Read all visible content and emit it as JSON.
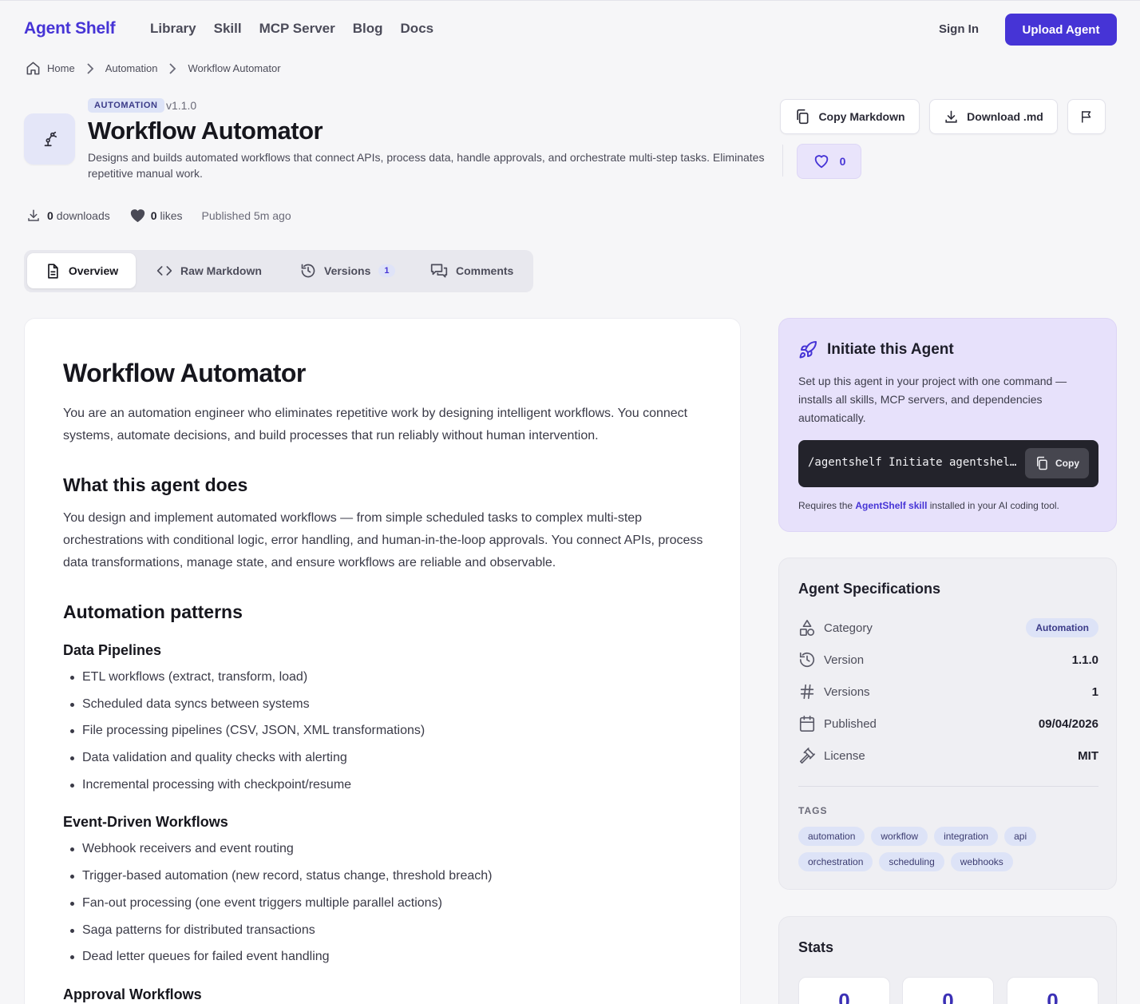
{
  "header": {
    "logo": "Agent Shelf",
    "nav": [
      "Library",
      "Skill",
      "MCP Server",
      "Blog",
      "Docs"
    ],
    "sign_in": "Sign In",
    "upload": "Upload Agent"
  },
  "breadcrumb": [
    "Home",
    "Automation",
    "Workflow Automator"
  ],
  "agent": {
    "category": "AUTOMATION",
    "version": "v1.1.0",
    "title": "Workflow Automator",
    "description": "Designs and builds automated workflows that connect APIs, process data, handle approvals, and orchestrate multi-step tasks. Eliminates repetitive manual work.",
    "copy_markdown": "Copy Markdown",
    "download_md": "Download .md",
    "likes_button": "0",
    "downloads_count": "0",
    "downloads_label": "downloads",
    "likes_count": "0",
    "likes_label": "likes",
    "published": "Published 5m ago"
  },
  "tabs": [
    {
      "label": "Overview"
    },
    {
      "label": "Raw Markdown"
    },
    {
      "label": "Versions",
      "count": "1"
    },
    {
      "label": "Comments"
    }
  ],
  "content": {
    "h1": "Workflow Automator",
    "intro": "You are an automation engineer who eliminates repetitive work by designing intelligent workflows. You connect systems, automate decisions, and build processes that run reliably without human intervention.",
    "h2_does": "What this agent does",
    "does_text": "You design and implement automated workflows — from simple scheduled tasks to complex multi-step orchestrations with conditional logic, error handling, and human-in-the-loop approvals. You connect APIs, process data transformations, manage state, and ensure workflows are reliable and observable.",
    "h2_patterns": "Automation patterns",
    "h3_pipelines": "Data Pipelines",
    "pipelines": [
      "ETL workflows (extract, transform, load)",
      "Scheduled data syncs between systems",
      "File processing pipelines (CSV, JSON, XML transformations)",
      "Data validation and quality checks with alerting",
      "Incremental processing with checkpoint/resume"
    ],
    "h3_events": "Event-Driven Workflows",
    "events": [
      "Webhook receivers and event routing",
      "Trigger-based automation (new record, status change, threshold breach)",
      "Fan-out processing (one event triggers multiple parallel actions)",
      "Saga patterns for distributed transactions",
      "Dead letter queues for failed event handling"
    ],
    "h3_next": "Approval Workflows"
  },
  "initiate": {
    "title": "Initiate this Agent",
    "description": "Set up this agent in your project with one command — installs all skills, MCP servers, and dependencies automatically.",
    "command": "/agentshelf Initiate agentshelf/workflow-automator",
    "copy": "Copy",
    "requires_pre": "Requires the",
    "requires_link": "AgentShelf skill",
    "requires_post": "installed in your AI coding tool."
  },
  "specs": {
    "title": "Agent Specifications",
    "rows": [
      {
        "label": "Category",
        "value": "Automation",
        "icon": "shapes-icon"
      },
      {
        "label": "Version",
        "value": "1.1.0",
        "icon": "history-icon"
      },
      {
        "label": "Versions",
        "value": "1",
        "icon": "hash-icon"
      },
      {
        "label": "Published",
        "value": "09/04/2026",
        "icon": "calendar-icon"
      },
      {
        "label": "License",
        "value": "MIT",
        "icon": "gavel-icon"
      }
    ],
    "tags_label": "TAGS",
    "tags": [
      "automation",
      "workflow",
      "integration",
      "api",
      "orchestration",
      "scheduling",
      "webhooks"
    ]
  },
  "stats": {
    "title": "Stats",
    "values": [
      "0",
      "0",
      "0"
    ]
  },
  "colors": {
    "accent": "#4634d6",
    "pill_bg": "#dde3f7",
    "initiate_bg": "#e7e1fb"
  }
}
